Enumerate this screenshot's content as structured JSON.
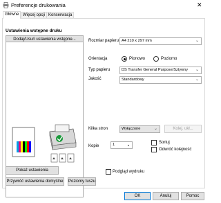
{
  "window": {
    "title": "Preferencje drukowania",
    "close_glyph": "✕"
  },
  "tabs": [
    {
      "label": "Główne"
    },
    {
      "label": "Więcej opcji"
    },
    {
      "label": "Konserwacja"
    }
  ],
  "presets": {
    "title": "Ustawienia wstępne druku",
    "add_button": "Dodaj/Usuń ustawienia wstępne..."
  },
  "settings": {
    "paper_size_label": "Rozmiar papieru",
    "paper_size_value": "A4 210 x 297 mm",
    "orientation_label": "Orientacja",
    "orientation_portrait": "Pionowo",
    "orientation_landscape": "Poziomo",
    "paper_type_label": "Typ papieru",
    "paper_type_value": "DS Transfer General Purpose/Sztywny",
    "quality_label": "Jakość",
    "quality_value": "Standardowy",
    "multipage_label": "Kilka stron",
    "multipage_value": "Wyłączone",
    "layout_button": "Kolej. ukł...",
    "copies_label": "Kopie",
    "copies_value": "1",
    "collate_label": "Sortuj",
    "reverse_label": "Odwróć kolejność",
    "preview_label": "Podgląd wydruku"
  },
  "buttons": {
    "show_settings": "Pokaż ustawienia",
    "restore_defaults": "Przywróć ustawienia domyślne",
    "ink_levels": "Poziomy tuszu",
    "ok": "OK",
    "cancel": "Anuluj",
    "help": "Pomoc"
  },
  "colors": {
    "accent": "#0078d7",
    "ink": [
      "#00a0e9",
      "#e4007f",
      "#fff100",
      "#000000",
      "#00ff00",
      "#ff0000"
    ]
  }
}
